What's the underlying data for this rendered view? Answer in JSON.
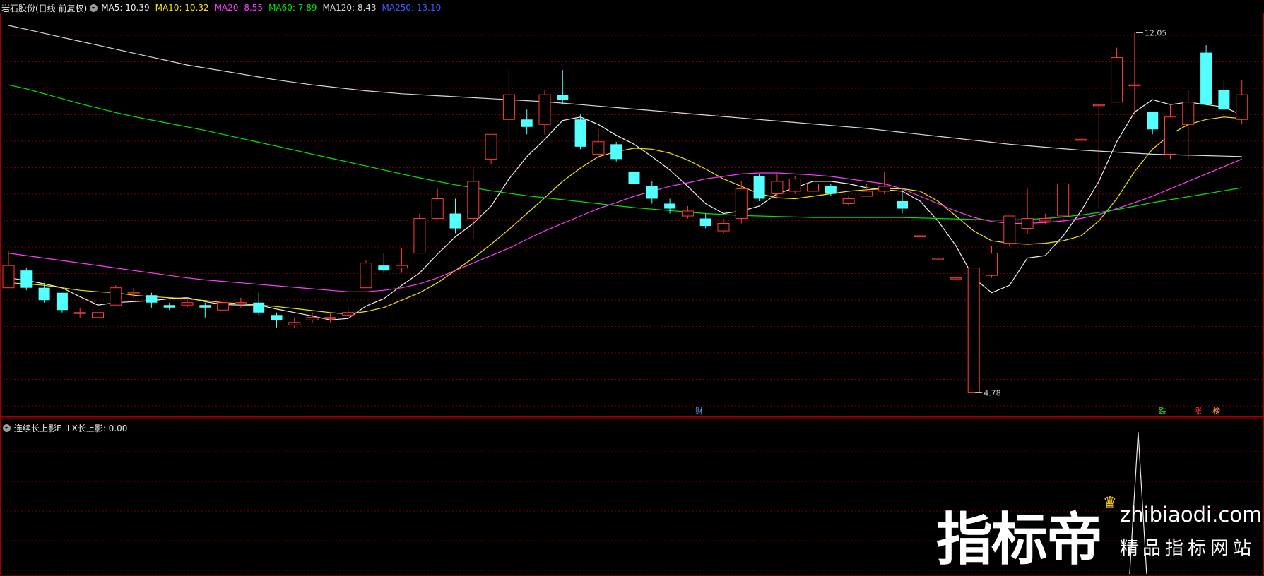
{
  "header": {
    "title": "岩石股份(日线 前复权)",
    "ma": [
      {
        "label": "MA5: 10.39",
        "color": "#f0f0f0"
      },
      {
        "label": "MA10: 10.32",
        "color": "#f2e600"
      },
      {
        "label": "MA20: 8.55",
        "color": "#ff3cff"
      },
      {
        "label": "MA60: 7.89",
        "color": "#00e600"
      },
      {
        "label": "MA120: 8.43",
        "color": "#d8d8d8"
      },
      {
        "label": "MA250: 13.10",
        "color": "#3c5aff"
      }
    ]
  },
  "annotations": {
    "high_label": "12.05",
    "low_label": "4.78",
    "event_cai": "财",
    "event_die": "跌",
    "event_zhang": "涨",
    "event_bang": "榜"
  },
  "indicator": {
    "name": "连续长上影F",
    "value_label": "LX长上影: 0.00"
  },
  "watermark": {
    "big": "指标帝",
    "url": "zhibiaodi.com",
    "sub": "精品指标网站"
  },
  "colors": {
    "up": "#ff3c3c",
    "down": "#54ffff",
    "grid": "#7a0000",
    "border": "#a00000"
  },
  "chart_data": {
    "type": "candlestick",
    "price_range": [
      4.5,
      12.4
    ],
    "candles": [
      [
        6.9,
        7.35,
        7.65,
        6.9
      ],
      [
        7.25,
        6.9,
        7.3,
        6.85
      ],
      [
        6.9,
        6.65,
        7.0,
        6.6
      ],
      [
        6.8,
        6.45,
        6.8,
        6.4
      ],
      [
        6.4,
        6.4,
        6.5,
        6.3
      ],
      [
        6.3,
        6.4,
        6.5,
        6.2
      ],
      [
        6.55,
        6.9,
        6.95,
        6.55
      ],
      [
        6.8,
        6.8,
        6.9,
        6.7
      ],
      [
        6.75,
        6.6,
        6.8,
        6.5
      ],
      [
        6.55,
        6.5,
        6.6,
        6.45
      ],
      [
        6.55,
        6.6,
        6.7,
        6.5
      ],
      [
        6.55,
        6.5,
        6.6,
        6.3
      ],
      [
        6.45,
        6.6,
        6.7,
        6.4
      ],
      [
        6.6,
        6.6,
        6.7,
        6.5
      ],
      [
        6.6,
        6.4,
        6.8,
        6.35
      ],
      [
        6.35,
        6.25,
        6.4,
        6.1
      ],
      [
        6.15,
        6.2,
        6.3,
        6.1
      ],
      [
        6.25,
        6.3,
        6.4,
        6.2
      ],
      [
        6.3,
        6.3,
        6.4,
        6.2
      ],
      [
        6.35,
        6.4,
        6.5,
        6.3
      ],
      [
        6.9,
        7.4,
        7.45,
        6.9
      ],
      [
        7.35,
        7.25,
        7.6,
        7.2
      ],
      [
        7.3,
        7.35,
        7.7,
        7.2
      ],
      [
        7.6,
        8.3,
        8.4,
        7.6
      ],
      [
        8.3,
        8.7,
        8.9,
        8.3
      ],
      [
        8.4,
        8.1,
        8.7,
        8.0
      ],
      [
        8.3,
        9.05,
        9.3,
        7.9
      ],
      [
        9.5,
        10.0,
        10.0,
        9.4
      ],
      [
        10.3,
        10.8,
        11.3,
        9.6
      ],
      [
        10.3,
        10.15,
        10.5,
        10.0
      ],
      [
        10.2,
        10.8,
        10.9,
        10.0
      ],
      [
        10.8,
        10.7,
        11.3,
        10.6
      ],
      [
        10.3,
        9.75,
        10.4,
        9.7
      ],
      [
        9.6,
        9.85,
        10.1,
        9.55
      ],
      [
        9.8,
        9.5,
        9.85,
        9.45
      ],
      [
        9.25,
        9.0,
        9.4,
        8.9
      ],
      [
        8.95,
        8.7,
        9.05,
        8.6
      ],
      [
        8.6,
        8.5,
        8.7,
        8.4
      ],
      [
        8.35,
        8.45,
        8.55,
        8.3
      ],
      [
        8.3,
        8.15,
        8.4,
        8.1
      ],
      [
        8.05,
        8.2,
        8.3,
        8.0
      ],
      [
        8.3,
        8.9,
        9.05,
        8.2
      ],
      [
        9.15,
        8.7,
        9.2,
        8.65
      ],
      [
        8.8,
        9.05,
        9.2,
        8.7
      ],
      [
        8.85,
        9.1,
        9.15,
        8.8
      ],
      [
        8.85,
        9.0,
        9.25,
        8.8
      ],
      [
        8.95,
        8.8,
        9.0,
        8.75
      ],
      [
        8.6,
        8.7,
        8.75,
        8.55
      ],
      [
        8.75,
        8.85,
        9.0,
        8.75
      ],
      [
        8.85,
        8.95,
        9.25,
        8.8
      ],
      [
        8.65,
        8.5,
        8.9,
        8.4
      ],
      [
        7.95,
        7.95,
        7.95,
        7.95
      ],
      [
        7.5,
        7.5,
        7.5,
        7.5
      ],
      [
        7.1,
        7.1,
        7.1,
        7.1
      ],
      [
        4.78,
        7.3,
        7.3,
        4.78
      ],
      [
        7.15,
        7.6,
        7.75,
        7.1
      ],
      [
        7.8,
        8.35,
        8.35,
        7.75
      ],
      [
        8.1,
        8.3,
        8.9,
        8.0
      ],
      [
        8.25,
        8.3,
        8.4,
        8.2
      ],
      [
        8.35,
        9.0,
        9.0,
        8.2
      ],
      [
        9.9,
        9.9,
        9.9,
        9.9
      ],
      [
        10.6,
        10.6,
        10.6,
        8.5
      ],
      [
        10.65,
        11.55,
        11.75,
        10.65
      ],
      [
        11.0,
        11.0,
        12.05,
        10.4
      ],
      [
        10.45,
        10.1,
        10.45,
        10.0
      ],
      [
        9.6,
        10.35,
        10.6,
        9.5
      ],
      [
        10.2,
        10.65,
        10.9,
        9.5
      ],
      [
        11.65,
        10.6,
        11.8,
        10.65
      ],
      [
        10.9,
        10.5,
        11.1,
        10.5
      ],
      [
        10.3,
        10.8,
        11.1,
        10.2
      ]
    ],
    "ma_series": [
      {
        "name": "MA5",
        "values": [
          7.1,
          7.05,
          6.98,
          6.9,
          6.72,
          6.55,
          6.6,
          6.62,
          6.64,
          6.68,
          6.7,
          6.62,
          6.56,
          6.55,
          6.55,
          6.47,
          6.4,
          6.33,
          6.25,
          6.28,
          6.53,
          6.68,
          6.95,
          7.2,
          7.58,
          7.93,
          8.2,
          8.55,
          9.1,
          9.55,
          9.9,
          10.28,
          10.35,
          10.2,
          9.98,
          9.8,
          9.55,
          9.28,
          8.95,
          8.6,
          8.4,
          8.45,
          8.55,
          8.8,
          8.92,
          9.05,
          9.05,
          9.0,
          8.92,
          8.88,
          8.85,
          8.65,
          8.25,
          7.75,
          7.1,
          6.8,
          6.95,
          7.5,
          7.55,
          7.95,
          8.45,
          9.05,
          9.85,
          10.45,
          10.7,
          10.6,
          10.65,
          10.6,
          10.55,
          10.39
        ]
      },
      {
        "name": "MA10",
        "values": [
          7.0,
          6.98,
          6.95,
          6.9,
          6.85,
          6.82,
          6.8,
          6.75,
          6.72,
          6.7,
          6.68,
          6.64,
          6.6,
          6.58,
          6.55,
          6.52,
          6.48,
          6.44,
          6.4,
          6.37,
          6.42,
          6.5,
          6.65,
          6.8,
          7.0,
          7.25,
          7.5,
          7.78,
          8.08,
          8.4,
          8.72,
          9.05,
          9.32,
          9.55,
          9.65,
          9.72,
          9.7,
          9.62,
          9.48,
          9.3,
          9.1,
          8.95,
          8.8,
          8.72,
          8.7,
          8.75,
          8.8,
          8.85,
          8.88,
          8.9,
          8.9,
          8.85,
          8.65,
          8.35,
          8.05,
          7.85,
          7.8,
          7.78,
          7.8,
          7.85,
          7.95,
          8.25,
          8.7,
          9.25,
          9.7,
          10.0,
          10.2,
          10.3,
          10.35,
          10.32
        ]
      },
      {
        "name": "MA20",
        "values": [
          7.6,
          7.55,
          7.5,
          7.45,
          7.4,
          7.35,
          7.3,
          7.25,
          7.2,
          7.15,
          7.1,
          7.06,
          7.03,
          7.0,
          6.97,
          6.94,
          6.91,
          6.88,
          6.85,
          6.82,
          6.82,
          6.85,
          6.9,
          6.98,
          7.1,
          7.25,
          7.4,
          7.55,
          7.7,
          7.88,
          8.05,
          8.2,
          8.35,
          8.5,
          8.62,
          8.75,
          8.85,
          8.95,
          9.02,
          9.1,
          9.15,
          9.2,
          9.22,
          9.22,
          9.2,
          9.18,
          9.15,
          9.1,
          9.05,
          9.0,
          8.9,
          8.75,
          8.6,
          8.45,
          8.32,
          8.24,
          8.2,
          8.2,
          8.22,
          8.25,
          8.3,
          8.38,
          8.5,
          8.62,
          8.75,
          8.9,
          9.05,
          9.2,
          9.35,
          9.5
        ]
      },
      {
        "name": "MA60",
        "values": [
          11.0,
          10.92,
          10.82,
          10.72,
          10.62,
          10.53,
          10.44,
          10.36,
          10.29,
          10.22,
          10.15,
          10.08,
          10.0,
          9.92,
          9.84,
          9.76,
          9.68,
          9.6,
          9.52,
          9.44,
          9.36,
          9.28,
          9.2,
          9.12,
          9.05,
          8.98,
          8.92,
          8.86,
          8.81,
          8.76,
          8.72,
          8.68,
          8.64,
          8.6,
          8.56,
          8.52,
          8.49,
          8.46,
          8.43,
          8.4,
          8.38,
          8.36,
          8.35,
          8.34,
          8.33,
          8.32,
          8.32,
          8.32,
          8.32,
          8.32,
          8.32,
          8.31,
          8.3,
          8.29,
          8.28,
          8.27,
          8.27,
          8.28,
          8.3,
          8.33,
          8.37,
          8.42,
          8.48,
          8.55,
          8.62,
          8.68,
          8.74,
          8.8,
          8.86,
          8.92
        ]
      },
      {
        "name": "MA120",
        "values": [
          12.2,
          12.12,
          12.04,
          11.96,
          11.88,
          11.8,
          11.72,
          11.64,
          11.56,
          11.48,
          11.4,
          11.34,
          11.28,
          11.22,
          11.16,
          11.1,
          11.05,
          11.0,
          10.96,
          10.92,
          10.88,
          10.85,
          10.82,
          10.8,
          10.78,
          10.76,
          10.74,
          10.72,
          10.7,
          10.68,
          10.66,
          10.63,
          10.6,
          10.57,
          10.54,
          10.51,
          10.48,
          10.45,
          10.42,
          10.39,
          10.36,
          10.33,
          10.3,
          10.27,
          10.24,
          10.21,
          10.18,
          10.15,
          10.12,
          10.08,
          10.04,
          10.0,
          9.96,
          9.92,
          9.88,
          9.84,
          9.8,
          9.77,
          9.74,
          9.71,
          9.68,
          9.66,
          9.64,
          9.62,
          9.6,
          9.59,
          9.58,
          9.57,
          9.56,
          9.55
        ]
      }
    ],
    "indicator_series": {
      "name": "LX长上影",
      "spike_index": 63,
      "spike_value": 1
    }
  }
}
